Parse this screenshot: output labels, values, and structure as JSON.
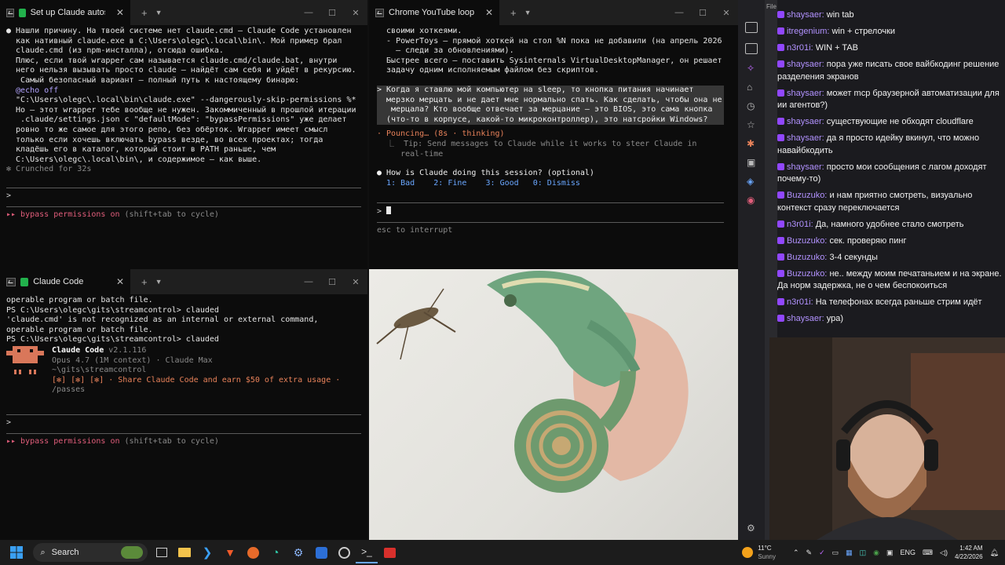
{
  "left_top_terminal": {
    "tab_title": "Set up Claude autostart w",
    "lines": [
      "● Нашли причину. На твоей системе нет claude.cmd — Claude Code установлен",
      "  как нативный claude.exe в C:\\Users\\olegc\\.local\\bin\\. Мой пример брал",
      "  claude.cmd (из npm-инсталла), отсюда ошибка.",
      "",
      "  Плюс, если твой wrapper сам называется claude.cmd/claude.bat, внутри",
      "  него нельзя вызывать просто claude — найдёт сам себя и уйдёт в рекурсию.",
      "   Самый безопасный вариант — полный путь к настоящему бинарю:",
      "",
      "  @echo off",
      "  \"C:\\Users\\olegc\\.local\\bin\\claude.exe\" --dangerously-skip-permissions %*",
      "",
      "  Но — этот wrapper тебе вообще не нужен. Закоммиченный в прошлой итерации",
      "   .claude/settings.json с \"defaultMode\": \"bypassPermissions\" уже делает",
      "  ровно то же самое для этого репо, без обёрток. Wrapper имеет смысл",
      "  только если хочешь включать bypass везде, во всех проектах; тогда",
      "  кладёшь его в каталог, который стоит в PATH раньше, чем",
      "  C:\\Users\\olegc\\.local\\bin\\, и содержимое — как выше.",
      "",
      "✻ Crunched for 32s"
    ],
    "prompt": ">",
    "mode": "▸▸ bypass permissions on",
    "mode_hint": "(shift+tab to cycle)"
  },
  "left_bottom_terminal": {
    "tab_title": "Claude Code",
    "lines": [
      "operable program or batch file.",
      "PS C:\\Users\\olegc\\gits\\streamcontrol> clauded",
      "'claude.cmd' is not recognized as an internal or external command,",
      "operable program or batch file.",
      "PS C:\\Users\\olegc\\gits\\streamcontrol> clauded"
    ],
    "banner": {
      "name": "Claude Code",
      "version": "v2.1.116",
      "model": "Opus 4.7 (1M context) · Claude Max",
      "cwd": "~\\gits\\streamcontrol",
      "promo": "[✻] [✻] [✻] · Share Claude Code and earn $50 of extra usage ·",
      "promo2": "/passes"
    },
    "prompt": ">",
    "mode": "▸▸ bypass permissions on",
    "mode_hint": "(shift+tab to cycle)"
  },
  "right_terminal": {
    "tab_title": "Chrome YouTube loop exte",
    "lines": [
      "  своими хоткеями.",
      "  - PowerToys — прямой хоткей на стол %N пока не добавили (на апрель 2026",
      "    — следи за обновлениями).",
      "",
      "  Быстрее всего — поставить Sysinternals VirtualDesktopManager, он решает",
      "  задачу одним исполняемым файлом без скриптов."
    ],
    "user_message": [
      "> Когда я ставлю мой компьютер на sleep, то кнопка питания начинает",
      "  мерзко мерцать и не дает мне нормально спать. Как сделать, чтобы она не",
      "   мерцала? Кто вообще отвечает за мерцание — это BIOS, это сама кнопка",
      "  (что-то в корпусе, какой-то микроконтроллер), это натсройки Windows?"
    ],
    "status": "· Pouncing… (8s · thinking)",
    "tip_1": "  ⎿  Tip: Send messages to Claude while it works to steer Claude in",
    "tip_2": "     real-time",
    "survey_q": "● How is Claude doing this session? (optional)",
    "survey_opts": [
      "1: Bad",
      "2: Fine",
      "3: Good",
      "0: Dismiss"
    ],
    "prompt": ">",
    "footer": "esc to interrupt"
  },
  "chat": {
    "messages": [
      {
        "nick": "shaysaer:",
        "text": "win tab"
      },
      {
        "nick": "itregenium:",
        "text": "win + стрелочки"
      },
      {
        "nick": "n3r01i:",
        "text": "WIN + TAB"
      },
      {
        "nick": "shaysaer:",
        "text": "пора уже писать свое вайбкодинг решение разделения экранов"
      },
      {
        "nick": "shaysaer:",
        "text": "может mcp браузерной автоматизации для ии агентов?)"
      },
      {
        "nick": "shaysaer:",
        "text": "существующие не обходят cloudflare"
      },
      {
        "nick": "shaysaer:",
        "text": "да я просто идейку вкинул, что можно навайбкодить"
      },
      {
        "nick": "shaysaer:",
        "text": "просто мои сообщения с лагом доходят почему-то)"
      },
      {
        "nick": "Buzuzuko:",
        "text": "и нам приятно смотреть, визуально контекст сразу переключается"
      },
      {
        "nick": "n3r01i:",
        "text": "Да, намного удобнее стало смотреть"
      },
      {
        "nick": "Buzuzuko:",
        "text": "сек. проверяю пинг"
      },
      {
        "nick": "Buzuzuko:",
        "text": "3-4 секунды"
      },
      {
        "nick": "Buzuzuko:",
        "text": "не.. между моим печатаньием и на экране. Да норм задержка, не о чем беспокоиться"
      },
      {
        "nick": "n3r01i:",
        "text": "На телефонах всегда раньше стрим идёт"
      },
      {
        "nick": "shaysaer:",
        "text": "ура)"
      }
    ]
  },
  "taskbar": {
    "search_label": "Search",
    "weather_temp": "11°C",
    "weather_desc": "Sunny",
    "lang": "ENG",
    "time": "1:42 AM",
    "date": "4/22/2026"
  },
  "colors": {
    "terminal_bg": "#0c0c0c",
    "claude_orange": "#e8825a",
    "bypass_pink": "#e05d7a",
    "chat_nick": "#b292ff",
    "taskbar_bg": "#1c1c1c"
  }
}
